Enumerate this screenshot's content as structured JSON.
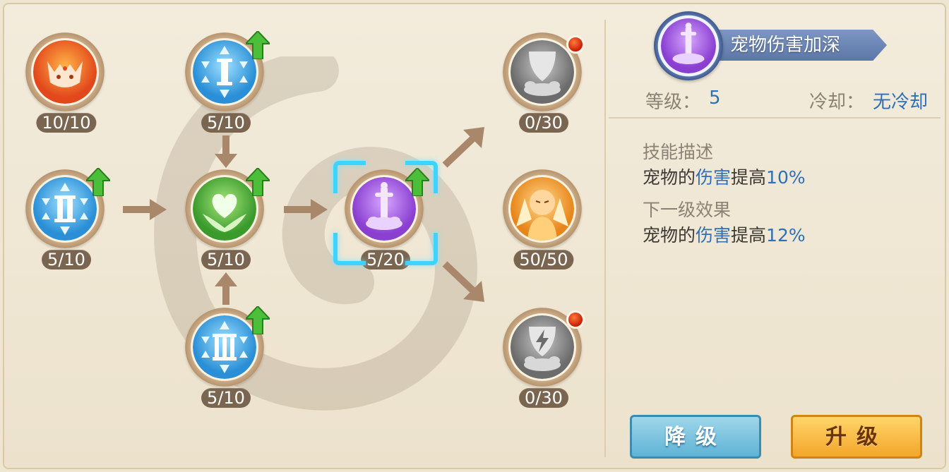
{
  "skill_tree": {
    "nodes": [
      {
        "id": "pet-fire-cat",
        "count": "10/10",
        "icon": "fire-cat-icon"
      },
      {
        "id": "skill-i",
        "count": "5/10",
        "icon": "roman-one-icon",
        "upgradable": true
      },
      {
        "id": "skill-ii",
        "count": "5/10",
        "icon": "roman-two-icon",
        "upgradable": true
      },
      {
        "id": "heart",
        "count": "5/10",
        "icon": "heart-icon",
        "upgradable": true
      },
      {
        "id": "skill-iii",
        "count": "5/10",
        "icon": "roman-three-icon",
        "upgradable": true
      },
      {
        "id": "sword",
        "count": "5/20",
        "icon": "sword-icon",
        "upgradable": true,
        "selected": true
      },
      {
        "id": "shield-locked",
        "count": "0/30",
        "icon": "shield-icon",
        "alert": true
      },
      {
        "id": "monk",
        "count": "50/50",
        "icon": "monk-icon"
      },
      {
        "id": "lightning-shield-locked",
        "count": "0/30",
        "icon": "lightning-shield-icon",
        "alert": true
      }
    ]
  },
  "detail": {
    "title": "宠物伤害加深",
    "level_label": "等级：",
    "level_value": "5",
    "cooldown_label": "冷却：",
    "cooldown_value": "无冷却",
    "desc_header": "技能描述",
    "desc_prefix": "宠物的",
    "desc_keyword": "伤害",
    "desc_mid": "提高",
    "desc_value": "10%",
    "next_header": "下一级效果",
    "next_prefix": "宠物的",
    "next_keyword": "伤害",
    "next_mid": "提高",
    "next_value": "12%"
  },
  "buttons": {
    "downgrade": "降级",
    "upgrade": "升级"
  },
  "colors": {
    "accent_blue": "#2e6fb8",
    "downgrade_button": "#5fb3d5",
    "upgrade_button": "#f3a62a",
    "count_badge": "#7a6550"
  }
}
